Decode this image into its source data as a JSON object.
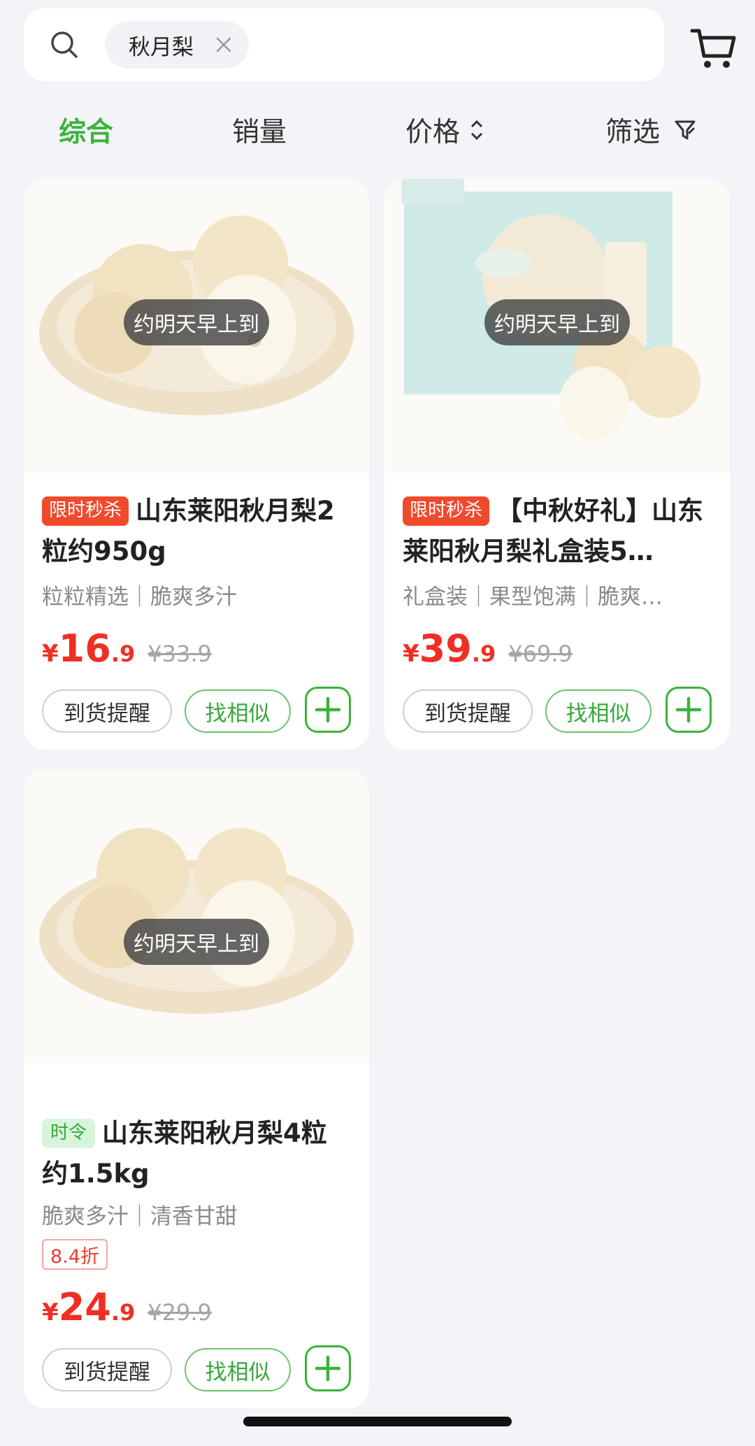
{
  "search": {
    "chip_text": "秋月梨"
  },
  "sort_bar": {
    "items": [
      {
        "label": "综合",
        "active": true
      },
      {
        "label": "销量"
      },
      {
        "label": "价格"
      },
      {
        "label": "筛选"
      }
    ]
  },
  "products": [
    {
      "eta": "约明天早上到",
      "tag": "限时秒杀",
      "title": "山东莱阳秋月梨2粒约950g",
      "subtitle": "粒粒精选｜脆爽多汁",
      "currency": "¥",
      "price_int": "16",
      "price_dec": ".9",
      "original_price": "¥33.9",
      "remind_label": "到货提醒",
      "similar_label": "找相似"
    },
    {
      "eta": "约明天早上到",
      "tag": "限时秒杀",
      "title": "【中秋好礼】山东莱阳秋月梨礼盒装5…",
      "subtitle": "礼盒装｜果型饱满｜脆爽…",
      "currency": "¥",
      "price_int": "39",
      "price_dec": ".9",
      "original_price": "¥69.9",
      "remind_label": "到货提醒",
      "similar_label": "找相似"
    },
    {
      "eta": "约明天早上到",
      "tag": "时令",
      "title": "山东莱阳秋月梨4粒约1.5kg",
      "subtitle": "脆爽多汁｜清香甘甜",
      "discount": "8.4折",
      "currency": "¥",
      "price_int": "24",
      "price_dec": ".9",
      "original_price": "¥29.9",
      "remind_label": "到货提醒",
      "similar_label": "找相似"
    }
  ]
}
